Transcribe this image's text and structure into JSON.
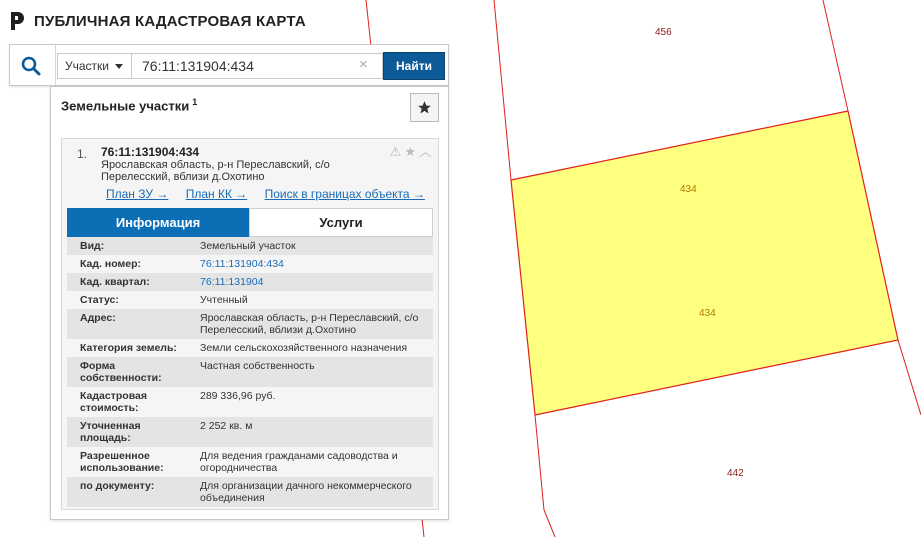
{
  "app": {
    "title": "ПУБЛИЧНАЯ КАДАСТРОВАЯ КАРТА"
  },
  "colors": {
    "accent": "#0c6fb6",
    "button": "#0c5b97",
    "parcel_fill": "#ffff80",
    "parcel_border": "#e0201a",
    "link": "#1a6bb5"
  },
  "search": {
    "type_label": "Участки",
    "query": "76:11:131904:434",
    "clear_label": "×",
    "find_label": "Найти"
  },
  "panel": {
    "title": "Земельные участки",
    "count": "1",
    "card": {
      "num": "1.",
      "cadnum": "76:11:131904:434",
      "address": "Ярославская область, р-н Переславский, с/о Перелесский, вблизи д.Охотино",
      "links": {
        "plan_zu": "План ЗУ →",
        "plan_kk": "План КК →",
        "search_bounds": "Поиск в границах объекта →"
      },
      "tabs": {
        "info": "Информация",
        "services": "Услуги"
      },
      "rows": [
        {
          "k": "Вид:",
          "v": "Земельный участок"
        },
        {
          "k": "Кад. номер:",
          "v": "76:11:131904:434"
        },
        {
          "k": "Кад. квартал:",
          "v": "76:11:131904"
        },
        {
          "k": "Статус:",
          "v": "Учтенный"
        },
        {
          "k": "Адрес:",
          "v": "Ярославская область, р-н Переславский, с/о Перелесский, вблизи д.Охотино"
        },
        {
          "k": "Категория земель:",
          "v": "Земли сельскохозяйственного назначения"
        },
        {
          "k": "Форма собственности:",
          "v": "Частная собственность"
        },
        {
          "k": "Кадастровая стоимость:",
          "v": "289 336,96 руб."
        },
        {
          "k": "Уточненная площадь:",
          "v": "2 252 кв. м"
        },
        {
          "k": "Разрешенное использование:",
          "v": "Для ведения гражданами садоводства и огородничества"
        },
        {
          "k": "по документу:",
          "v": "Для организации дачного некоммерческого объединения"
        }
      ]
    }
  },
  "map": {
    "labels": {
      "p456": "456",
      "p434a": "434",
      "p434b": "434",
      "p442": "442"
    }
  }
}
